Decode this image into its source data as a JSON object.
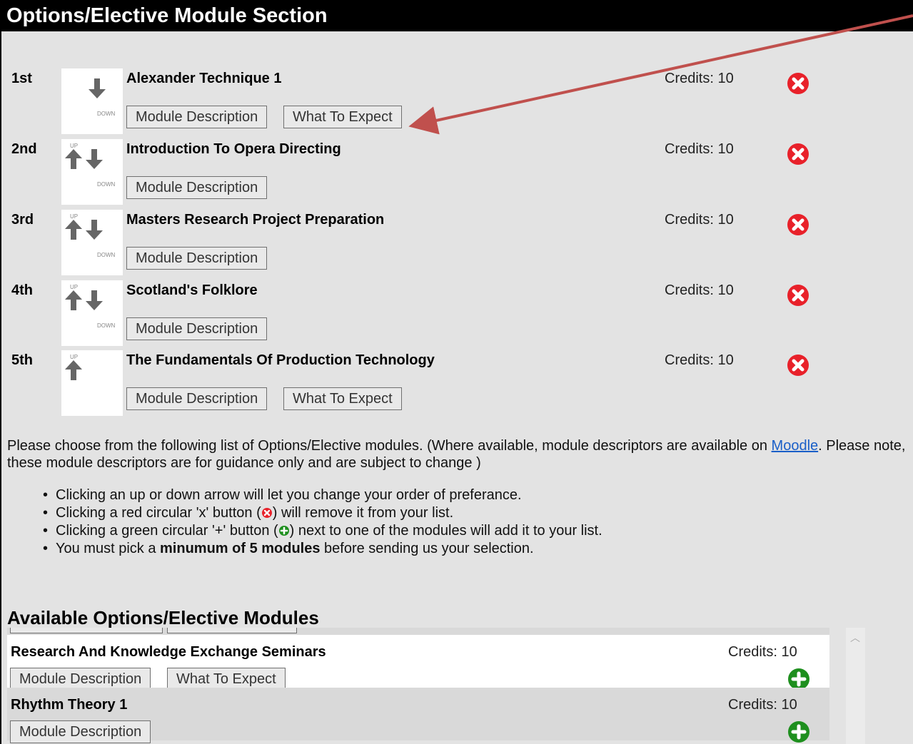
{
  "page": {
    "title": "Options/Elective Module Section"
  },
  "selected_modules": [
    {
      "rank": "1st",
      "title": "Alexander Technique 1",
      "credits": "Credits: 10",
      "up": false,
      "down": true,
      "buttons": [
        "Module Description",
        "What To Expect"
      ]
    },
    {
      "rank": "2nd",
      "title": "Introduction To Opera Directing",
      "credits": "Credits: 10",
      "up": true,
      "down": true,
      "buttons": [
        "Module Description"
      ]
    },
    {
      "rank": "3rd",
      "title": "Masters Research Project Preparation",
      "credits": "Credits: 10",
      "up": true,
      "down": true,
      "buttons": [
        "Module Description"
      ]
    },
    {
      "rank": "4th",
      "title": "Scotland's Folklore",
      "credits": "Credits: 10",
      "up": true,
      "down": true,
      "buttons": [
        "Module Description"
      ]
    },
    {
      "rank": "5th",
      "title": "The Fundamentals Of Production Technology",
      "credits": "Credits: 10",
      "up": true,
      "down": false,
      "buttons": [
        "Module Description",
        "What To Expect"
      ]
    }
  ],
  "arrow_labels": {
    "up": "UP",
    "down": "DOWN"
  },
  "instructions": {
    "intro_before_link": "Please choose from the following list of Options/Elective modules. (Where available, module descriptors are available on ",
    "link_text": "Moodle",
    "intro_after_link": ". Please note, these module descriptors are for guidance only and are subject to change )",
    "bullet_1": "Clicking an up or down arrow will let you change your order of preferance.",
    "bullet_2_before": "Clicking a red circular 'x' button (",
    "bullet_2_after": ") will remove it from your list.",
    "bullet_3_before": "Clicking a green circular '+' button (",
    "bullet_3_after": ") next to one of the modules will add it to your list.",
    "bullet_4_before": "You must pick a ",
    "bullet_4_bold": "minumum of 5 modules",
    "bullet_4_after": " before sending us your selection."
  },
  "available": {
    "heading": "Available Options/Elective Modules",
    "items": [
      {
        "title": "Research And Knowledge Exchange Seminars",
        "credits": "Credits: 10",
        "buttons": [
          "Module Description",
          "What To Expect"
        ],
        "background": "#ffffff"
      },
      {
        "title": "Rhythm Theory 1",
        "credits": "Credits: 10",
        "buttons": [
          "Module Description"
        ],
        "background": "#d9d9d9"
      }
    ]
  },
  "colors": {
    "remove": "#e8212a",
    "add": "#1e8f1e",
    "annotation_arrow": "#c0504d"
  },
  "icons": {
    "remove": "red-x-circle-icon",
    "add": "green-plus-circle-icon",
    "up": "up-arrow-icon",
    "down": "down-arrow-icon"
  }
}
